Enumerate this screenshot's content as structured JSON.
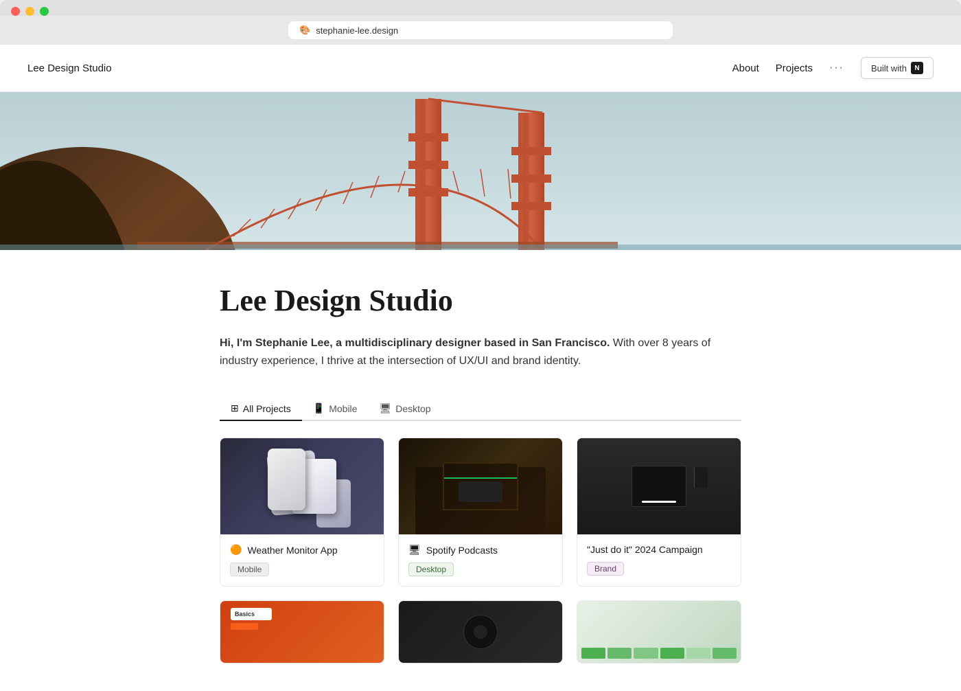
{
  "browser": {
    "url": "stephanie-lee.design",
    "favicon": "🎨",
    "tab_label": "Lee Design Studio"
  },
  "nav": {
    "logo": "Lee Design Studio",
    "links": [
      "About",
      "Projects"
    ],
    "dots": "···",
    "built_with_label": "Built with",
    "built_with_icon": "N"
  },
  "hero": {
    "alt": "Golden Gate Bridge"
  },
  "content": {
    "title": "Lee Design Studio",
    "description_bold": "Hi, I'm Stephanie Lee, a multidisciplinary designer based in San Francisco.",
    "description_rest": " With over 8 years of industry experience, I thrive at the intersection of UX/UI and brand identity."
  },
  "filters": {
    "tabs": [
      {
        "label": "All Projects",
        "icon": "⊞",
        "active": true
      },
      {
        "label": "Mobile",
        "icon": "📱",
        "active": false
      },
      {
        "label": "Desktop",
        "icon": "🖥",
        "active": false
      }
    ]
  },
  "projects": [
    {
      "name": "Weather Monitor App",
      "emoji": "🟠",
      "tag": "Mobile",
      "tag_type": "mobile",
      "image_type": "weather"
    },
    {
      "name": "Spotify Podcasts",
      "emoji": "🖥",
      "tag": "Desktop",
      "tag_type": "desktop",
      "image_type": "spotify"
    },
    {
      "name": "\"Just do it\" 2024 Campaign",
      "emoji": "",
      "tag": "Brand",
      "tag_type": "brand",
      "image_type": "nike"
    },
    {
      "name": "",
      "emoji": "",
      "tag": "",
      "tag_type": "row2-1",
      "image_type": "row2-1"
    },
    {
      "name": "",
      "emoji": "",
      "tag": "",
      "tag_type": "row2-2",
      "image_type": "row2-2"
    },
    {
      "name": "",
      "emoji": "",
      "tag": "",
      "tag_type": "row2-3",
      "image_type": "row2-3"
    }
  ],
  "colors": {
    "accent": "#1a1a1a",
    "background": "#ffffff",
    "border": "#e8e8e8"
  }
}
